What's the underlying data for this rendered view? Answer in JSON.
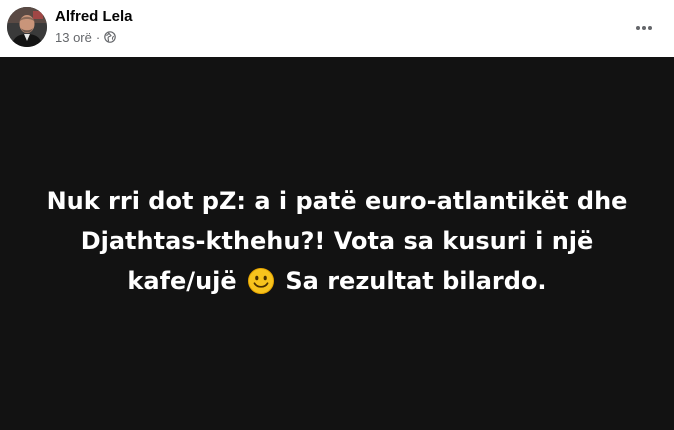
{
  "post": {
    "author": "Alfred Lela",
    "timestamp": "13 orë",
    "separator": "·",
    "privacy_icon": "globe-icon",
    "more_icon": "more-options-icon",
    "avatar_icon": "avatar",
    "text_line1": "Nuk rri dot pZ: a i patë euro-atlantikët dhe",
    "text_line2": "Djathtas-kthehu?! Vota sa kusuri i një",
    "text_line3_part1": "kafe/ujë",
    "text_line3_emoji": "slightly-smiling-face-emoji",
    "text_line3_part2": "Sa rezultat bilardo.",
    "background_color": "#121212",
    "text_color": "#ffffff"
  }
}
